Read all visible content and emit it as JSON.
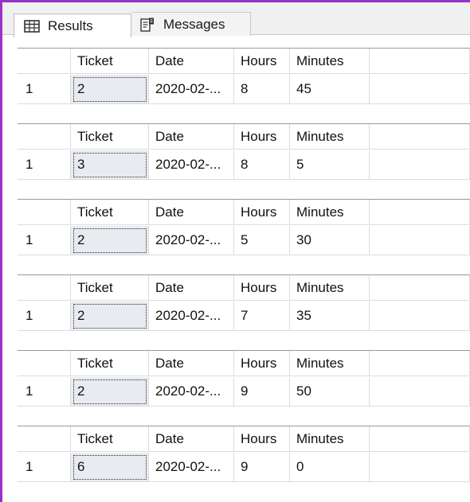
{
  "tabs": {
    "results_label": "Results",
    "messages_label": "Messages"
  },
  "columns": [
    "Ticket",
    "Date",
    "Hours",
    "Minutes"
  ],
  "result_sets": [
    {
      "row_number": "1",
      "ticket": "2",
      "date": "2020-02-...",
      "hours": "8",
      "minutes": "45"
    },
    {
      "row_number": "1",
      "ticket": "3",
      "date": "2020-02-...",
      "hours": "8",
      "minutes": "5"
    },
    {
      "row_number": "1",
      "ticket": "2",
      "date": "2020-02-...",
      "hours": "5",
      "minutes": "30"
    },
    {
      "row_number": "1",
      "ticket": "2",
      "date": "2020-02-...",
      "hours": "7",
      "minutes": "35"
    },
    {
      "row_number": "1",
      "ticket": "2",
      "date": "2020-02-...",
      "hours": "9",
      "minutes": "50"
    },
    {
      "row_number": "1",
      "ticket": "6",
      "date": "2020-02-...",
      "hours": "9",
      "minutes": "0"
    }
  ],
  "colors": {
    "accent": "#9b30c8",
    "selected_cell": "#e8ecf1"
  }
}
